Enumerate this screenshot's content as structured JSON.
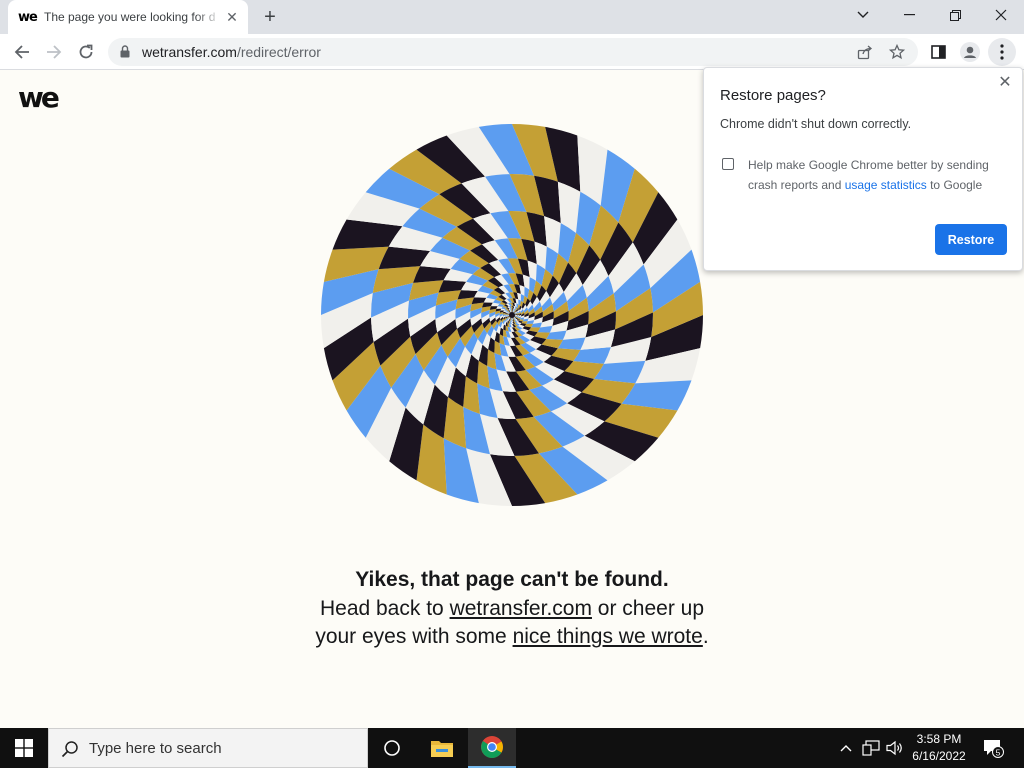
{
  "browser": {
    "tab": {
      "favicon_text": "we",
      "title": "The page you were looking for d",
      "close_symbol": "✕"
    },
    "new_tab_symbol": "+",
    "address": {
      "host": "wetransfer.com",
      "path": "/redirect/error"
    },
    "icons": {
      "back": "arrow-left-icon",
      "forward": "arrow-right-icon",
      "reload": "reload-icon",
      "lock": "lock-icon",
      "share": "share-icon",
      "bookmark": "star-icon",
      "side_panel": "side-panel-icon",
      "profile": "profile-icon",
      "menu": "kebab-menu-icon"
    }
  },
  "page": {
    "logo_text": "we",
    "heading": "Yikes, that page can't be found.",
    "line_prefix": "Head back to ",
    "link_home": "wetransfer.com",
    "line_middle": " or cheer up your eyes with some ",
    "link_nice": "nice things we wrote",
    "line_suffix": ".",
    "spiral_colors": [
      "#1b1420",
      "#f1f0ec",
      "#5c9df0",
      "#c4a035"
    ]
  },
  "dialog": {
    "title": "Restore pages?",
    "subtitle": "Chrome didn't shut down correctly.",
    "checkbox_checked": false,
    "help_prefix": "Help make Google Chrome better by sending crash reports and ",
    "help_link": "usage statistics",
    "help_suffix": " to Google",
    "restore_label": "Restore",
    "close_symbol": "✕",
    "accent": "#1a73e8"
  },
  "taskbar": {
    "search_placeholder": "Type here to search",
    "time": "3:58 PM",
    "date": "6/16/2022",
    "notification_count": "5"
  }
}
